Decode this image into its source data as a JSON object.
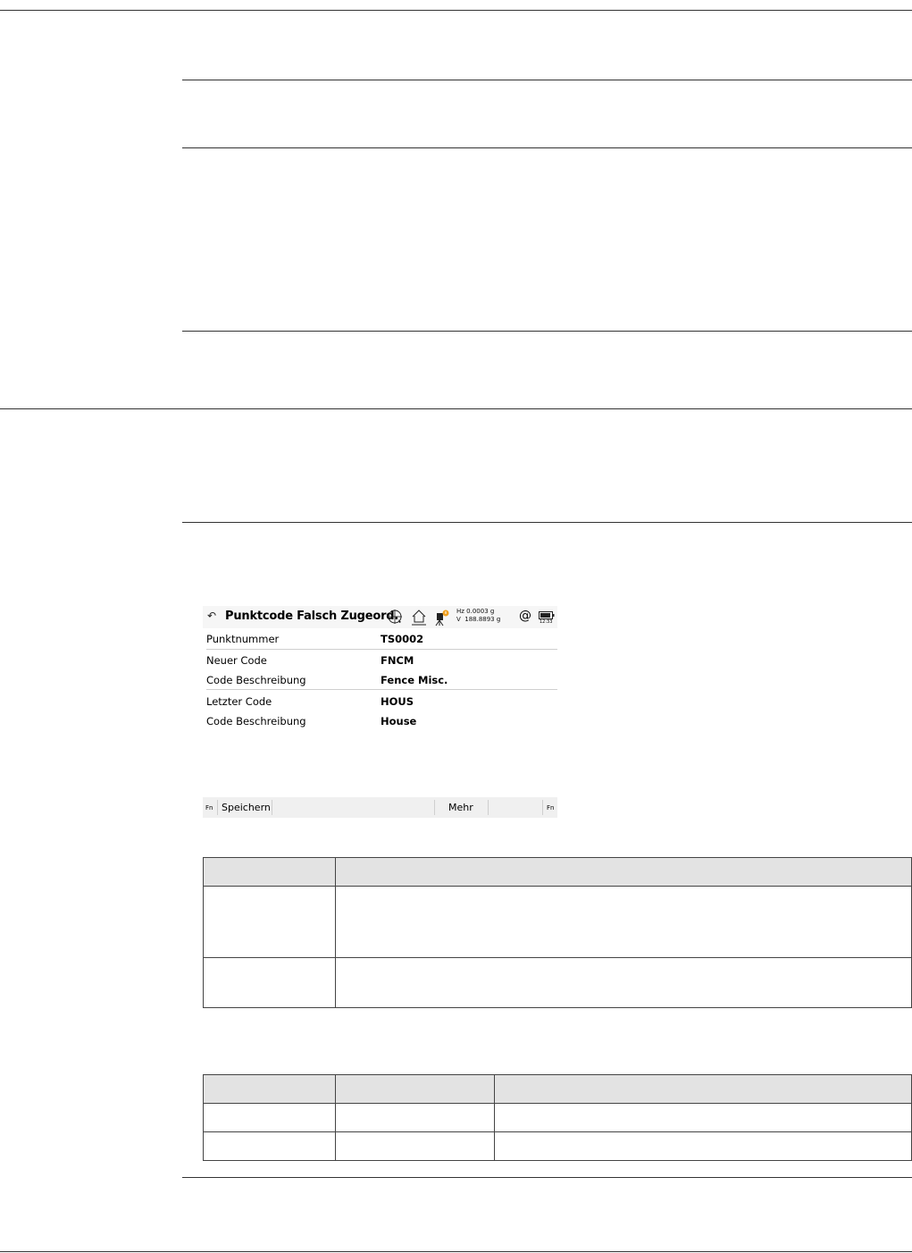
{
  "screen": {
    "back_icon": "back-arrow-icon",
    "title": "Punktcode Falsch Zugeord.",
    "status_icons": [
      "target-icon",
      "home-icon",
      "instrument-warning-icon",
      "at-icon",
      "battery-icon"
    ],
    "angles": {
      "hz": "Hz 0.0003 g",
      "v": "V  188.8893 g"
    },
    "at_symbol": "@",
    "time": "12:33",
    "fields": [
      {
        "label": "Punktnummer",
        "value": "TS0002"
      },
      {
        "label": "Neuer Code",
        "value": "FNCM"
      },
      {
        "label": "Code Beschreibung",
        "value": "Fence Misc."
      },
      {
        "label": "Letzter Code",
        "value": "HOUS"
      },
      {
        "label": "Code Beschreibung",
        "value": "House"
      }
    ],
    "softkeys": {
      "fn_left": "Fn",
      "save": "Speichern",
      "more": "Mehr",
      "fn_right": "Fn"
    }
  }
}
